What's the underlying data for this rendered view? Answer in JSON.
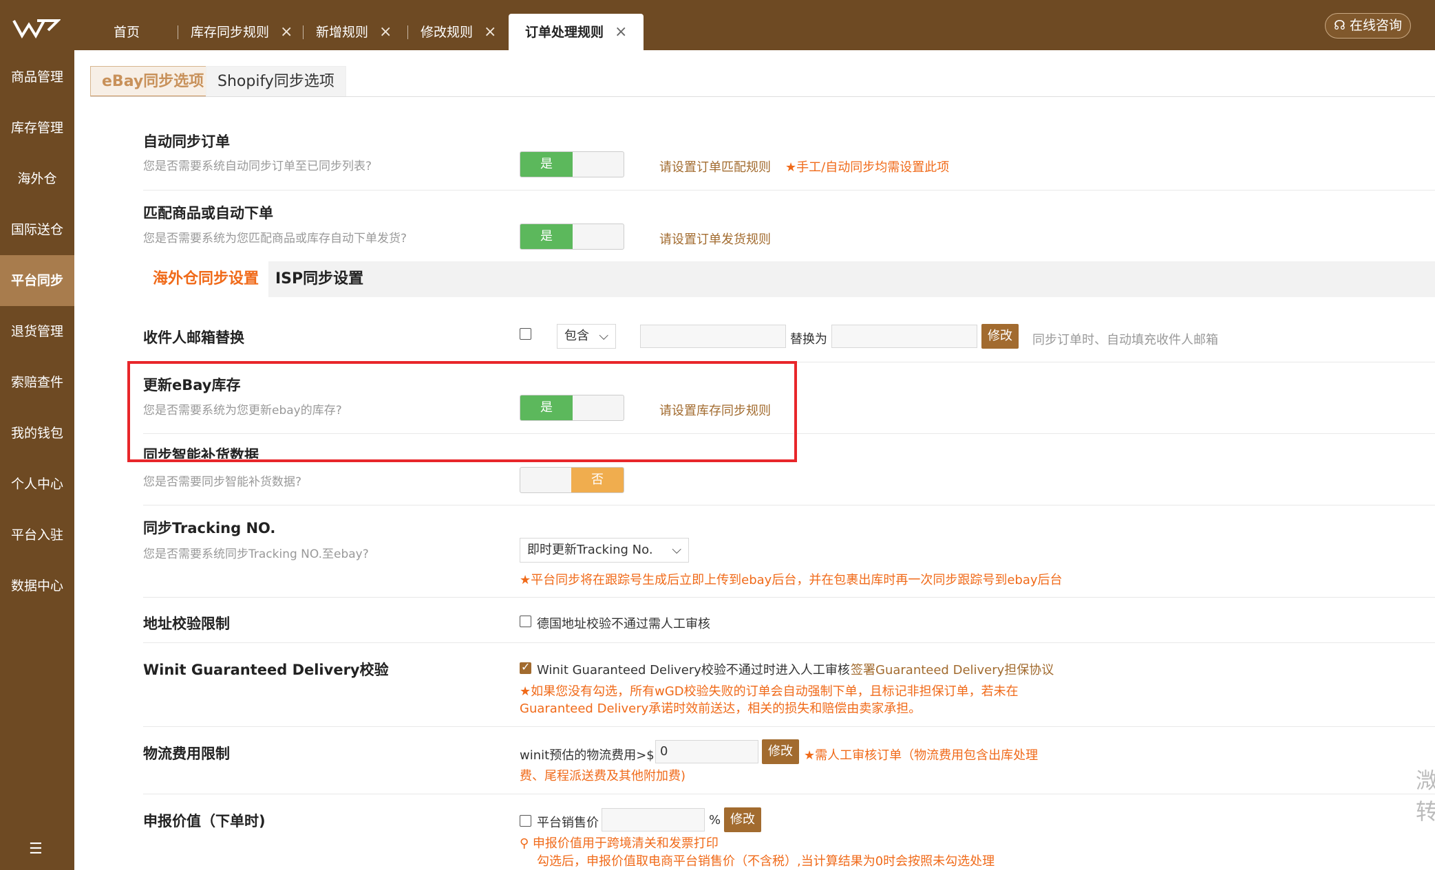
{
  "topbar": {
    "tabs": [
      {
        "label": "首页"
      },
      {
        "label": "库存同步规则",
        "close": "×"
      },
      {
        "label": "新增规则",
        "close": "×"
      },
      {
        "label": "修改规则",
        "close": "×"
      },
      {
        "label": "订单处理规则",
        "close": "×"
      }
    ],
    "consult": "在线咨询"
  },
  "sidebar": {
    "items": [
      "商品管理",
      "库存管理",
      "海外仓",
      "国际送仓",
      "平台同步",
      "退货管理",
      "索赔查件",
      "我的钱包",
      "个人中心",
      "平台入驻",
      "数据中心"
    ],
    "active": "平台同步",
    "collapse_icon": "☰"
  },
  "subtabs": {
    "ebay": "eBay同步选项",
    "shopify": "Shopify同步选项"
  },
  "auto_sync": {
    "title": "自动同步订单",
    "desc": "您是否需要系统自动同步订单至已同步列表?",
    "toggle": "是",
    "link": "请设置订单匹配规则",
    "note": "手工/自动同步均需设置此项"
  },
  "match": {
    "title": "匹配商品或自动下单",
    "desc": "您是否需要系统为您匹配商品或库存自动下单发货?",
    "toggle": "是",
    "link": "请设置订单发货规则"
  },
  "band": {
    "overseas": "海外仓同步设置",
    "isp": "ISP同步设置"
  },
  "email": {
    "title": "收件人邮箱替换",
    "select": "包含",
    "replace_label": "替换为",
    "button": "修改",
    "note": "同步订单时、自动填充收件人邮箱"
  },
  "update_stock": {
    "title": "更新eBay库存",
    "desc": "您是否需要系统为您更新ebay的库存?",
    "toggle": "是",
    "link": "请设置库存同步规则"
  },
  "replenish": {
    "title": "同步智能补货数据",
    "desc": "您是否需要同步智能补货数据?",
    "toggle": "否"
  },
  "tracking": {
    "title": "同步Tracking NO.",
    "desc": "您是否需要系统同步Tracking NO.至ebay?",
    "select": "即时更新Tracking No.",
    "note": "平台同步将在跟踪号生成后立即上传到ebay后台，并在包裹出库时再一次同步跟踪号到ebay后台"
  },
  "address": {
    "title": "地址校验限制",
    "checkbox_label": "德国地址校验不通过需人工审核"
  },
  "wgd": {
    "title": "Winit Guaranteed Delivery校验",
    "checkbox_label": "Winit Guaranteed Delivery校验不通过时进入人工审核",
    "link": "签署Guaranteed Delivery担保协议",
    "note1": "如果您没有勾选，所有wGD校验失败的订单会自动强制下单，且标记非担保订单，若未在",
    "note2": "Guaranteed Delivery承诺时效前送达，相关的损失和赔偿由卖家承担。"
  },
  "logistics": {
    "title": "物流费用限制",
    "label": "winit预估的物流费用>$",
    "value": "0",
    "button": "修改",
    "note1": "需人工审核订单（物流费用包含出库处理",
    "note2": "费、尾程派送费及其他附加费)"
  },
  "declared": {
    "title": "申报价值（下单时)",
    "checkbox_label": "平台销售价",
    "percent": "%",
    "button": "修改",
    "note1": "申报价值用于跨境清关和发票打印",
    "note2": "勾选后，申报价值取电商平台销售价（不含税）,当计算结果为0时会按照未勾选处理"
  },
  "edge_text": [
    "溦",
    "转"
  ],
  "colors": {
    "brown": "#6e4a23",
    "accent": "#a26b2f",
    "orange": "#f06a19",
    "green": "#5cb85c",
    "red_box": "#e8262a"
  }
}
